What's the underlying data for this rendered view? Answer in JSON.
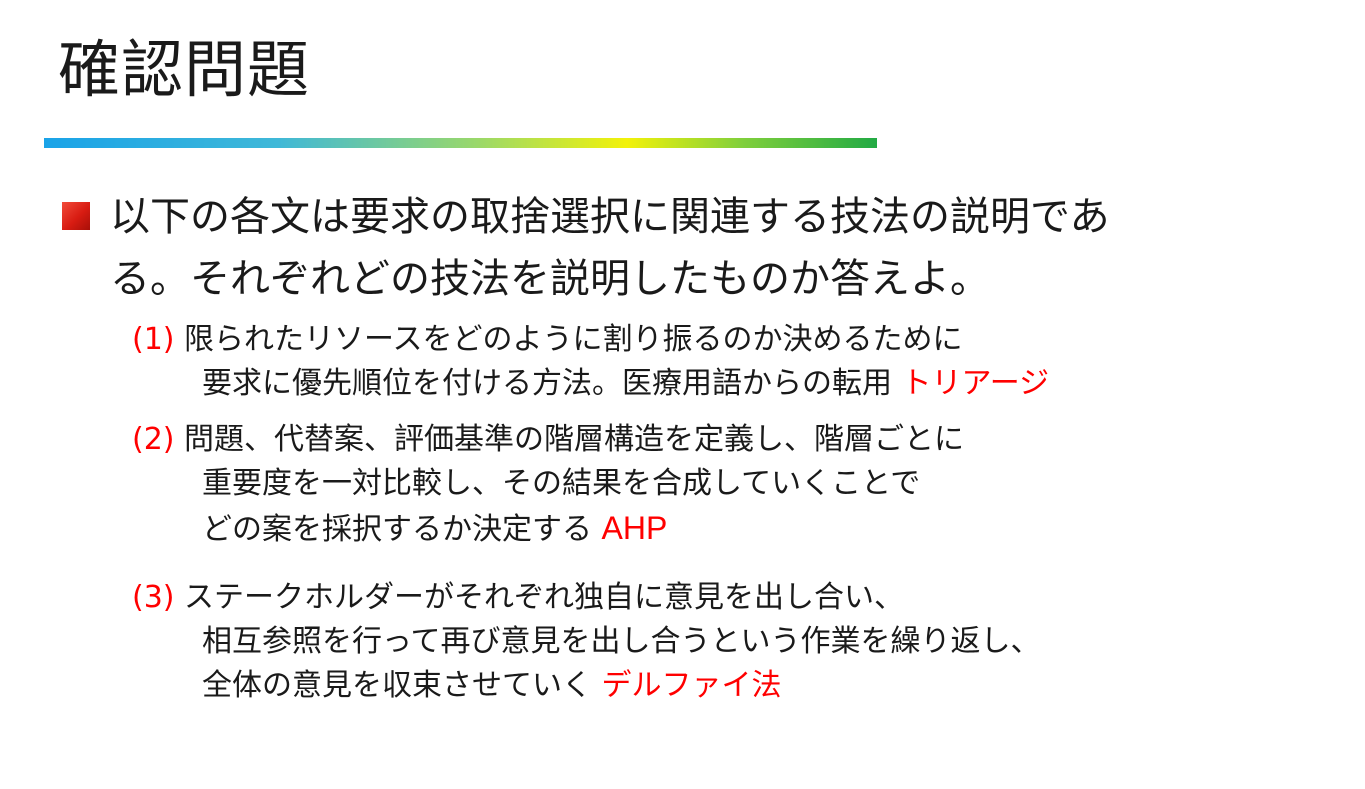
{
  "slide": {
    "title": "確認問題"
  },
  "bullet": {
    "line1": "以下の各文は要求の取捨選択に関連する技法の説明であ",
    "line2": "る。それぞれどの技法を説明したものか答えよ。"
  },
  "questions": [
    {
      "number": "(1)",
      "lines": [
        "限られたリソースをどのように割り振るのか決めるために",
        "要求に優先順位を付ける方法。医療用語からの転用"
      ],
      "answer": "トリアージ"
    },
    {
      "number": "(2)",
      "lines": [
        "問題、代替案、評価基準の階層構造を定義し、階層ごとに",
        "重要度を一対比較し、その結果を合成していくことで",
        "どの案を採択するか決定する"
      ],
      "answer": "AHP"
    },
    {
      "number": "(3)",
      "lines": [
        "ステークホルダーがそれぞれ独自に意見を出し合い、",
        "相互参照を行って再び意見を出し合うという作業を繰り返し、",
        "全体の意見を収束させていく"
      ],
      "answer": "デルファイ法"
    }
  ],
  "colors": {
    "answer": "#ff0000",
    "bullet": "#d81c12"
  }
}
